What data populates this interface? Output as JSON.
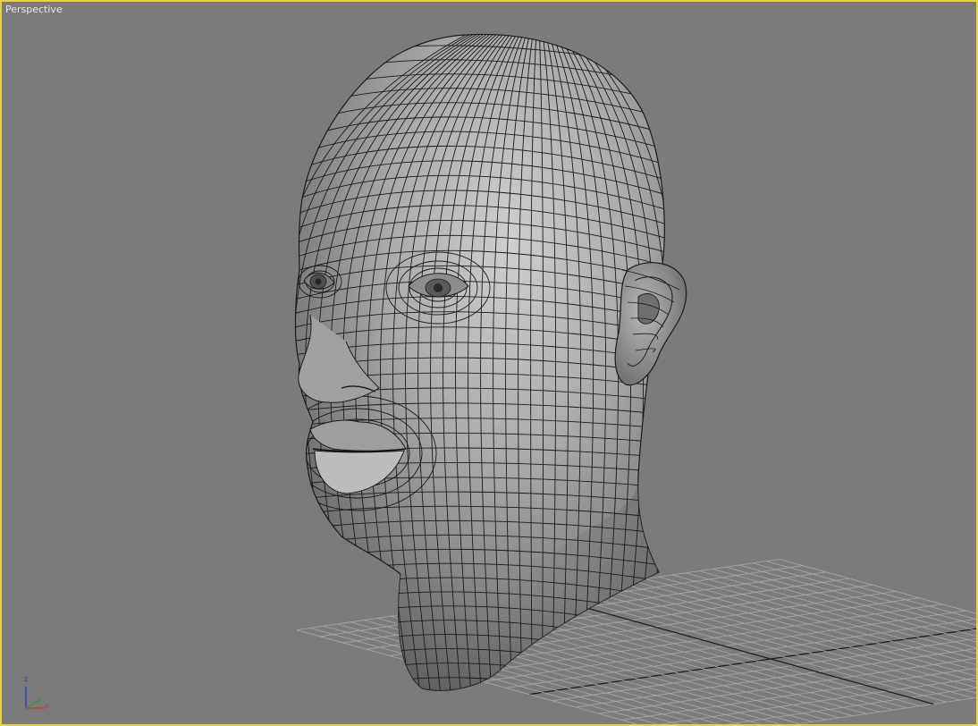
{
  "viewport": {
    "label": "Perspective",
    "border_color": "#e8d33a",
    "background": "#7b7b7b"
  },
  "model": {
    "name": "head-mesh",
    "display": "smooth-shaded-with-wireframe"
  },
  "axis_gizmo": {
    "x_label": "x",
    "y_label": "y",
    "z_label": "z",
    "x_color": "#d23a2a",
    "y_color": "#2f9a2f",
    "z_color": "#2a3fd0"
  },
  "colors": {
    "grid": "#a8a8a8",
    "grid_axis": "#1a1a1a",
    "wire": "#1a1a1a"
  }
}
